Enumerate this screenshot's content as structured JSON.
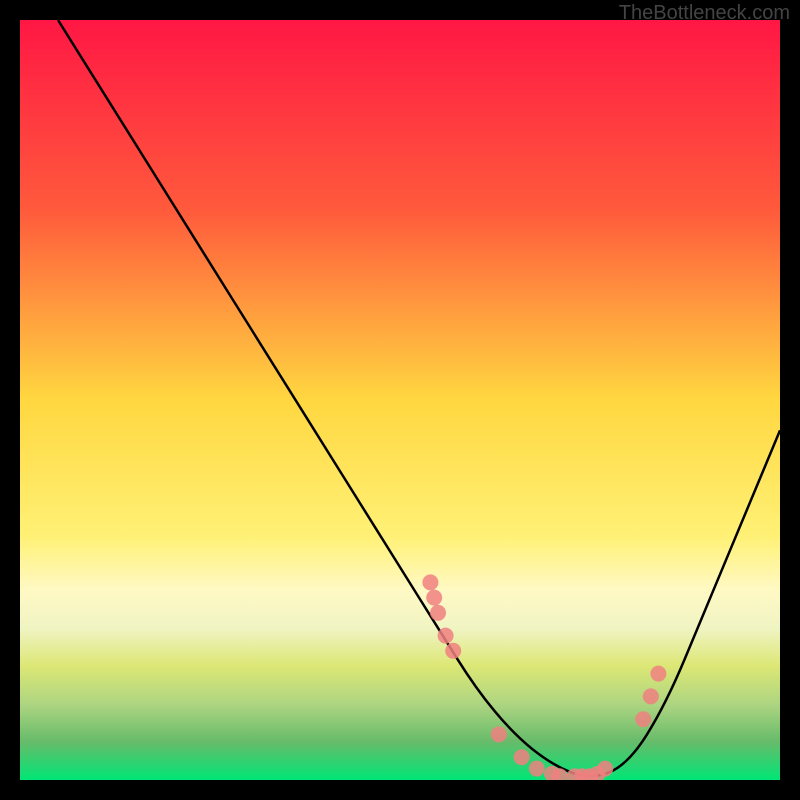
{
  "watermark": "TheBottleneck.com",
  "chart_data": {
    "type": "line",
    "title": "",
    "xlabel": "",
    "ylabel": "",
    "ylim": [
      0,
      100
    ],
    "xlim": [
      0,
      100
    ],
    "curve": {
      "x": [
        5,
        10,
        15,
        20,
        25,
        30,
        35,
        40,
        45,
        50,
        55,
        60,
        65,
        70,
        75,
        80,
        85,
        90,
        95,
        100
      ],
      "y": [
        100,
        92,
        84,
        76,
        68,
        60,
        52,
        44,
        36,
        28,
        20,
        12,
        6,
        2,
        0,
        2,
        10,
        22,
        34,
        46
      ]
    },
    "data_points": {
      "x_percent": [
        54,
        54.5,
        55,
        56,
        57,
        63,
        66,
        68,
        70,
        71,
        73,
        74,
        75,
        76,
        77,
        82,
        83,
        84
      ],
      "y_percent": [
        26,
        24,
        22,
        19,
        17,
        6,
        3,
        1.5,
        0.8,
        0.5,
        0.5,
        0.5,
        0.5,
        0.8,
        1.5,
        8,
        11,
        14
      ]
    },
    "gradient_stops": [
      {
        "offset": 0,
        "color": "#ff1744"
      },
      {
        "offset": 25,
        "color": "#ff5a3c"
      },
      {
        "offset": 50,
        "color": "#ffd740"
      },
      {
        "offset": 68,
        "color": "#fff176"
      },
      {
        "offset": 75,
        "color": "#fff9c4"
      },
      {
        "offset": 80,
        "color": "#f0f4c3"
      },
      {
        "offset": 85,
        "color": "#dce775"
      },
      {
        "offset": 90,
        "color": "#aed581"
      },
      {
        "offset": 95,
        "color": "#66bb6a"
      },
      {
        "offset": 100,
        "color": "#00e676"
      }
    ],
    "point_color": "#f08080",
    "curve_color": "#000000"
  }
}
